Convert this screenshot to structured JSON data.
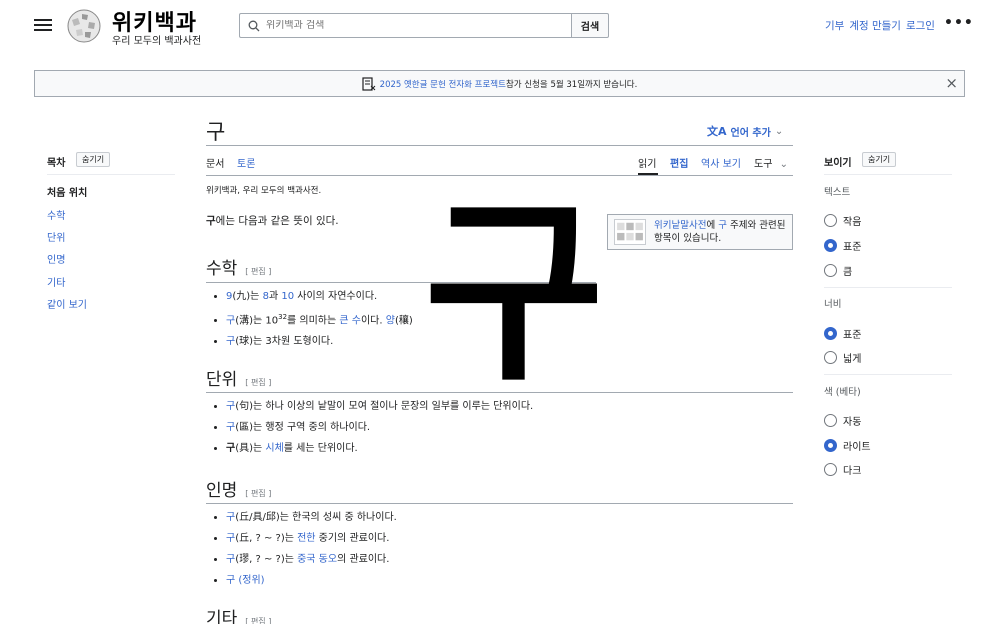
{
  "header": {
    "wordmark": "위키백과",
    "tagline": "우리 모두의 백과사전",
    "search_placeholder": "위키백과 검색",
    "search_button": "검색",
    "user_links": [
      "기부",
      "계정 만들기",
      "로그인"
    ],
    "more": "•••"
  },
  "banner": {
    "link_text": "2025 옛한글 문헌 전자화 프로젝트",
    "rest_text": " 참가 신청을 5월 31일까지 받습니다.",
    "close": "×"
  },
  "toc": {
    "title": "목차",
    "hide": "숨기기",
    "items": [
      "처음 위치",
      "수학",
      "단위",
      "인명",
      "기타",
      "같이 보기"
    ]
  },
  "page": {
    "title": "구",
    "lang_button": "언어 추가",
    "tabs_left": [
      "문서",
      "토론"
    ],
    "tabs_right": [
      "읽기",
      "편집",
      "역사 보기",
      "도구"
    ],
    "site_sub": "위키백과, 우리 모두의 백과사전.",
    "intro_bold": "구",
    "intro_rest": "에는 다음과 같은 뜻이 있다.",
    "big_glyph": "구"
  },
  "sister": {
    "link": "위키낱말사전",
    "mid": "에 ",
    "word": "구",
    "rest": " 주제와 관련된 항목이 있습니다."
  },
  "sections": {
    "edit_label": "[ 편집 ]",
    "math": {
      "title": "수학",
      "items": [
        {
          "a": "9",
          "b": "(九)는 ",
          "c": "8",
          "d": "과 ",
          "e": "10",
          "f": " 사이의 자연수이다."
        },
        {
          "a": "구",
          "b": "(溝)는 10",
          "sup": "32",
          "c": "를 의미하는 ",
          "d": "큰 수",
          "e": "이다. ",
          "f": "양",
          "g": "(穰)"
        },
        {
          "a": "구",
          "b": "(球)는 3차원 도형이다."
        }
      ]
    },
    "unit": {
      "title": "단위",
      "items": [
        {
          "a": "구",
          "b": "(句)는 하나 이상의 낱말이 모여 절이나 문장의 일부를 이루는 단위이다."
        },
        {
          "a": "구",
          "b": "(區)는 행정 구역 중의 하나이다."
        },
        {
          "a": "구",
          "b": "(具)는 ",
          "c": "시체",
          "d": "를 세는 단위이다."
        }
      ]
    },
    "person": {
      "title": "인명",
      "items": [
        {
          "a": "구",
          "b": "(丘/具/邱)는 한국의 성씨 중 하나이다."
        },
        {
          "a": "구",
          "b": "(丘, ? ~ ?)는 ",
          "c": "전한",
          "d": " 중기의 관료이다."
        },
        {
          "a": "구",
          "b": "(璆, ? ~ ?)는 ",
          "c": "중국 동오",
          "d": "의 관료이다."
        },
        {
          "a": "구 (정위)"
        }
      ]
    },
    "etc": {
      "title": "기타"
    }
  },
  "appearance": {
    "title": "보이기",
    "hide": "숨기기",
    "text_label": "텍스트",
    "text_options": [
      "작음",
      "표준",
      "큼"
    ],
    "text_selected": "표준",
    "width_label": "너비",
    "width_options": [
      "표준",
      "넓게"
    ],
    "width_selected": "표준",
    "color_label": "색 (베타)",
    "color_options": [
      "자동",
      "라이트",
      "다크"
    ],
    "color_selected": "라이트"
  },
  "colors": {
    "link": "#3366cc",
    "text": "#202122",
    "border": "#a2a9b1"
  }
}
